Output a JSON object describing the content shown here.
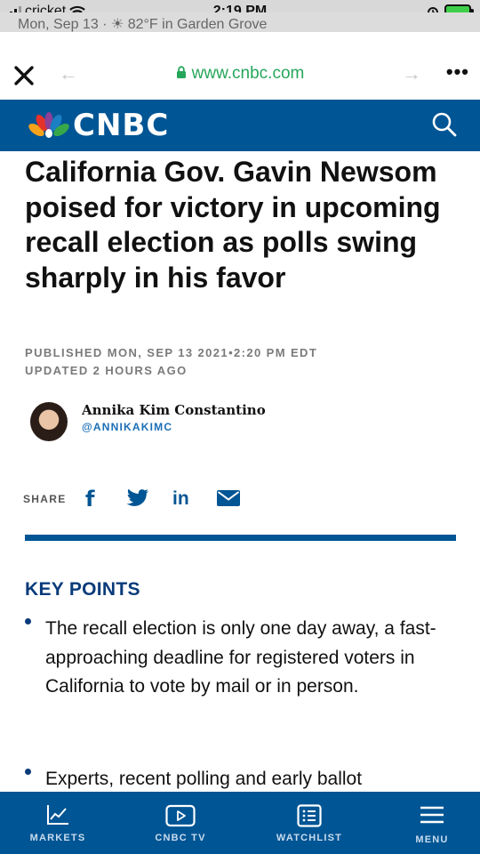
{
  "status_bar": {
    "carrier": "cricket",
    "time": "2:19 PM",
    "behind_text": "Mon, Sep 13 · ☀ 82°F in Garden Grove"
  },
  "browser": {
    "url": "www.cnbc.com",
    "url_color": "#26a65b"
  },
  "site": {
    "brand": "CNBC",
    "brand_color": "#005594"
  },
  "article": {
    "headline": "California Gov. Gavin Newsom poised for victory in upcoming recall election as polls swing sharply in his favor",
    "published": "PUBLISHED MON, SEP 13 2021•2:20 PM EDT",
    "updated": "UPDATED 2 HOURS AGO",
    "author_name": "Annika Kim Constantino",
    "author_handle": "@ANNIKAKIMC",
    "share_label": "SHARE"
  },
  "key_points": {
    "title": "KEY POINTS",
    "items": [
      "The recall election is only one day away, a fast-approaching deadline for registered voters in California to vote by mail or in person.",
      "Experts, recent polling and early ballot"
    ]
  },
  "bottom_nav": [
    {
      "label": "MARKETS",
      "icon": "chart-icon"
    },
    {
      "label": "CNBC TV",
      "icon": "play-icon"
    },
    {
      "label": "WATCHLIST",
      "icon": "list-icon"
    },
    {
      "label": "MENU",
      "icon": "hamburger-icon"
    }
  ]
}
